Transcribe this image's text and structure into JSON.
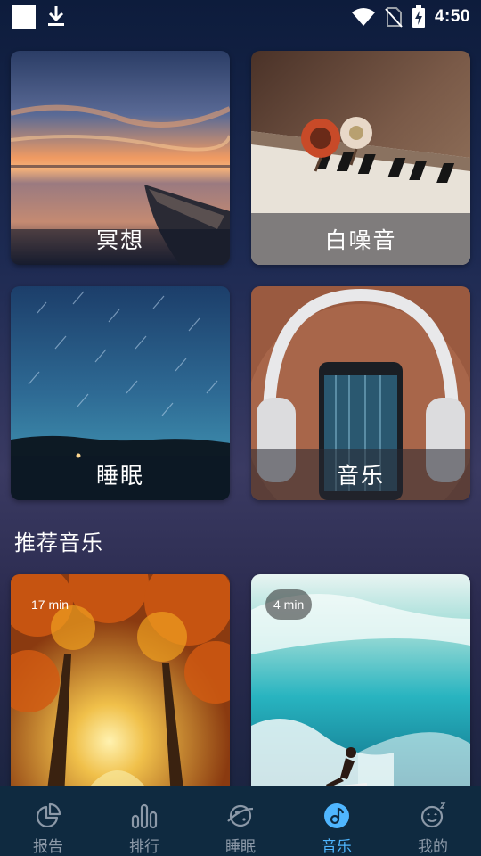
{
  "status_bar": {
    "time": "4:50",
    "icons": [
      "square-icon",
      "download-icon",
      "wifi-icon",
      "no-sim-icon",
      "battery-charging-icon"
    ]
  },
  "categories": [
    {
      "id": "meditation",
      "label": "冥想"
    },
    {
      "id": "whitenoise",
      "label": "白噪音"
    },
    {
      "id": "sleep",
      "label": "睡眠"
    },
    {
      "id": "music",
      "label": "音乐"
    }
  ],
  "recommended": {
    "title": "推荐音乐",
    "items": [
      {
        "duration": "17 min"
      },
      {
        "duration": "4 min"
      }
    ]
  },
  "bottom_nav": {
    "active": "音乐",
    "items": [
      {
        "label": "报告",
        "icon": "pie-chart-icon"
      },
      {
        "label": "排行",
        "icon": "bar-chart-icon"
      },
      {
        "label": "睡眠",
        "icon": "planet-icon"
      },
      {
        "label": "音乐",
        "icon": "music-note-icon"
      },
      {
        "label": "我的",
        "icon": "sleepy-face-icon"
      }
    ]
  },
  "colors": {
    "accent": "#4fb6ff",
    "nav_background": "#0f2a40",
    "nav_inactive": "#8c99a8"
  }
}
